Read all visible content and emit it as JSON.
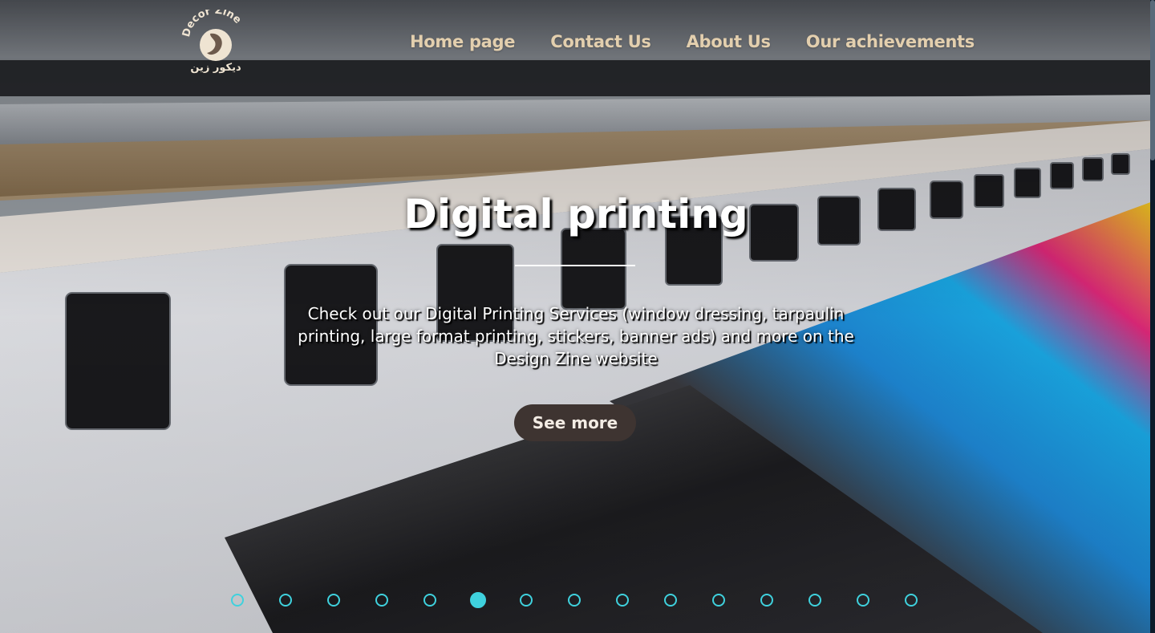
{
  "header": {
    "logo": {
      "text_latin": "Decor Zine",
      "text_arabic": "ديكور زين"
    },
    "nav": [
      {
        "label": "Home page"
      },
      {
        "label": "Contact Us"
      },
      {
        "label": "About Us"
      },
      {
        "label": "Our achievements"
      }
    ]
  },
  "hero": {
    "title": "Digital printing",
    "description": "Check out our Digital Printing Services (window dressing, tarpaulin printing, large format printing, stickers, banner ads) and more on the Design Zine website",
    "cta_label": "See more"
  },
  "carousel": {
    "slide_count": 15,
    "active_index": 5
  },
  "colors": {
    "nav_text": "#e3cfae",
    "button_bg": "#3e3431",
    "indicator": "#3fd1dd"
  }
}
